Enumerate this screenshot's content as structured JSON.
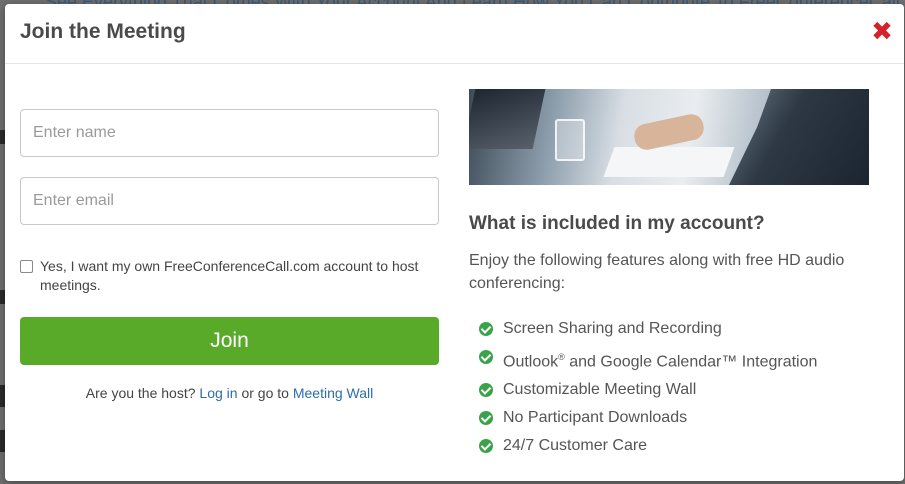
{
  "background": {
    "top_text": "See Everything That Comes With Your Account And Learn How You Can Contribute To FreeConferenceCall.com"
  },
  "modal": {
    "title": "Join the Meeting",
    "close_glyph": "✖"
  },
  "form": {
    "name_placeholder": "Enter name",
    "email_placeholder": "Enter email",
    "host_checkbox_label": "Yes, I want my own FreeConferenceCall.com account to host meetings.",
    "join_label": "Join",
    "host_prompt": "Are you the host?",
    "login_link": "Log in",
    "or_go_to": "or go to",
    "meeting_wall_link": "Meeting Wall"
  },
  "info": {
    "heading": "What is included in my account?",
    "intro": "Enjoy the following features along with free HD audio conferencing:",
    "features": [
      "Screen Sharing and Recording",
      "Outlook",
      "Customizable Meeting Wall",
      "No Participant Downloads",
      "24/7 Customer Care"
    ],
    "feature_2_mark": "®",
    "feature_2_rest": " and Google Calendar™ Integration"
  },
  "colors": {
    "join_button": "#5aaa2a",
    "close_icon": "#d2232a",
    "check_icon": "#3aa34a",
    "link": "#2c6dab"
  },
  "icons": {
    "close": "close-icon",
    "feature_bullet": "check-circle-icon"
  }
}
